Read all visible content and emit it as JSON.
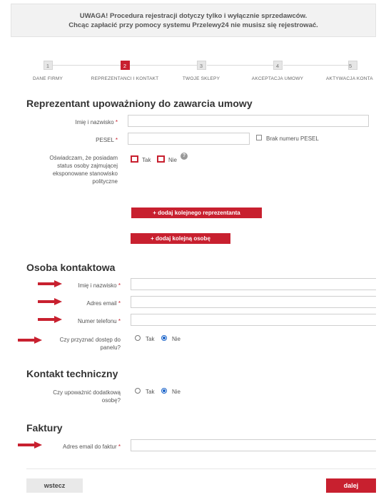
{
  "notice": {
    "line1": "UWAGA! Procedura rejestracji dotyczy tylko i wyłącznie sprzedawców.",
    "line2": "Chcąc zapłacić przy pomocy systemu Przelewy24 nie musisz się rejestrować."
  },
  "steps": [
    {
      "num": "1",
      "label": "DANE FIRMY"
    },
    {
      "num": "2",
      "label": "REPREZENTANCI I KONTAKT"
    },
    {
      "num": "3",
      "label": "TWOJE SKLEPY"
    },
    {
      "num": "4",
      "label": "AKCEPTACJA UMOWY"
    },
    {
      "num": "5",
      "label": "AKTYWACJA KONTA"
    }
  ],
  "representative": {
    "title": "Reprezentant upoważniony do zawarcia umowy",
    "name_label": "Imię i nazwisko",
    "pesel_label": "PESEL",
    "no_pesel_label": "Brak numeru PESEL",
    "pep_label_lines": [
      "Oświadczam, że posiadam",
      "status osoby zajmującej",
      "eksponowane stanowisko",
      "polityczne"
    ],
    "yes_label": "Tak",
    "no_label": "Nie",
    "help_glyph": "?",
    "add_rep_button": "+ dodaj kolejnego reprezentanta",
    "add_person_button": "+ dodaj kolejną osobę"
  },
  "contact": {
    "title": "Osoba kontaktowa",
    "name_label": "Imię i nazwisko",
    "email_label": "Adres email",
    "phone_label": "Numer telefonu",
    "access_label_lines": [
      "Czy przyznać dostęp do",
      "panelu?"
    ],
    "yes_label": "Tak",
    "no_label": "Nie",
    "access_selected": "Nie"
  },
  "technical": {
    "title": "Kontakt techniczny",
    "question_lines": [
      "Czy upoważnić dodatkową",
      "osobę?"
    ],
    "yes_label": "Tak",
    "no_label": "Nie",
    "selected": "Nie"
  },
  "invoices": {
    "title": "Faktury",
    "email_label": "Adres email do faktur"
  },
  "required_mark": "*",
  "nav": {
    "back": "wstecz",
    "next": "dalej"
  },
  "colors": {
    "accent": "#c8202f",
    "radio_selected": "#1a63c9"
  }
}
